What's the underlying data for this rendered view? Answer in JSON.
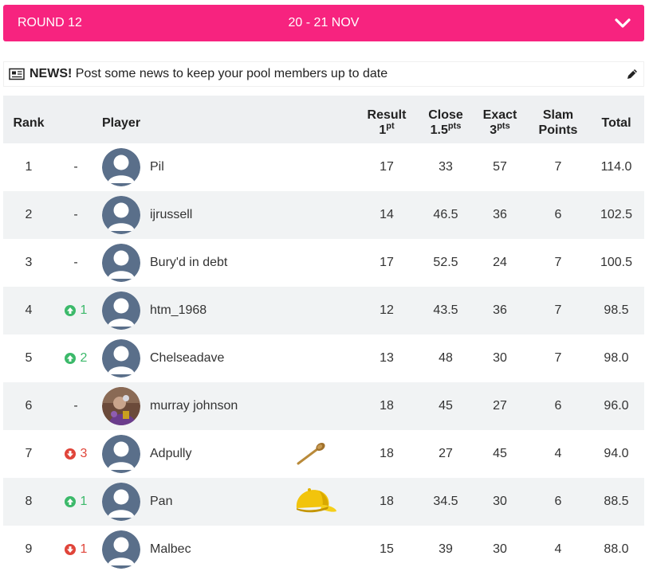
{
  "round": {
    "label": "ROUND 12",
    "dates": "20 - 21 NOV",
    "toggle_icon": "chevron-down-icon"
  },
  "news": {
    "bold": "NEWS!",
    "text": "Post some news to keep your pool members up to date",
    "icon": "newspaper-icon",
    "edit_icon": "pencil-icon"
  },
  "table": {
    "headers": {
      "rank": "Rank",
      "player": "Player",
      "result": "Result",
      "result_pts": "1",
      "result_unit": "pt",
      "close": "Close",
      "close_pts": "1.5",
      "close_unit": "pts",
      "exact": "Exact",
      "exact_pts": "3",
      "exact_unit": "pts",
      "slam_line1": "Slam",
      "slam_line2": "Points",
      "total": "Total"
    },
    "rows": [
      {
        "rank": "1",
        "move": "-",
        "direction": "none",
        "avatar": "default",
        "name": "Pil",
        "badge": "",
        "result": "17",
        "close": "33",
        "exact": "57",
        "slam": "7",
        "total": "114.0"
      },
      {
        "rank": "2",
        "move": "-",
        "direction": "none",
        "avatar": "default",
        "name": "ijrussell",
        "badge": "",
        "result": "14",
        "close": "46.5",
        "exact": "36",
        "slam": "6",
        "total": "102.5"
      },
      {
        "rank": "3",
        "move": "-",
        "direction": "none",
        "avatar": "default",
        "name": "Bury'd in debt",
        "badge": "",
        "result": "17",
        "close": "52.5",
        "exact": "24",
        "slam": "7",
        "total": "100.5"
      },
      {
        "rank": "4",
        "move": "1",
        "direction": "up",
        "avatar": "default",
        "name": "htm_1968",
        "badge": "",
        "result": "12",
        "close": "43.5",
        "exact": "36",
        "slam": "7",
        "total": "98.5"
      },
      {
        "rank": "5",
        "move": "2",
        "direction": "up",
        "avatar": "default",
        "name": "Chelseadave",
        "badge": "",
        "result": "13",
        "close": "48",
        "exact": "30",
        "slam": "7",
        "total": "98.0"
      },
      {
        "rank": "6",
        "move": "-",
        "direction": "none",
        "avatar": "photo",
        "name": "murray johnson",
        "badge": "",
        "result": "18",
        "close": "45",
        "exact": "27",
        "slam": "6",
        "total": "96.0"
      },
      {
        "rank": "7",
        "move": "3",
        "direction": "down",
        "avatar": "default",
        "name": "Adpully",
        "badge": "wooden-spoon-icon",
        "result": "18",
        "close": "27",
        "exact": "45",
        "slam": "4",
        "total": "94.0"
      },
      {
        "rank": "8",
        "move": "1",
        "direction": "up",
        "avatar": "default",
        "name": "Pan",
        "badge": "yellow-cap-icon",
        "result": "18",
        "close": "34.5",
        "exact": "30",
        "slam": "6",
        "total": "88.5"
      },
      {
        "rank": "9",
        "move": "1",
        "direction": "down",
        "avatar": "default",
        "name": "Malbec",
        "badge": "",
        "result": "15",
        "close": "39",
        "exact": "30",
        "slam": "4",
        "total": "88.0"
      }
    ]
  },
  "colors": {
    "accent": "#f7237f",
    "up": "#3cb96a",
    "down": "#e0453a",
    "avatar_bg": "#5a6f8a"
  }
}
